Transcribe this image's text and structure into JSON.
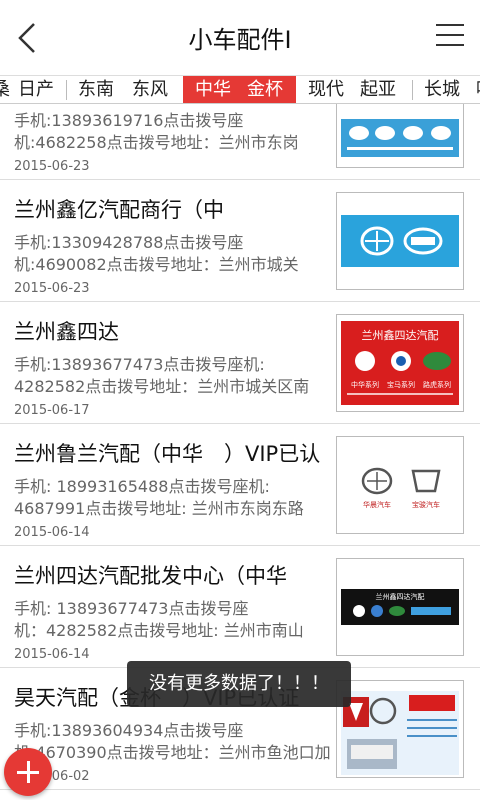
{
  "header": {
    "title": "小车配件Ⅰ"
  },
  "tabs": [
    {
      "label": "桑"
    },
    {
      "label": "日产"
    },
    {
      "label": "东南"
    },
    {
      "label": "东风"
    },
    {
      "label": "中华"
    },
    {
      "label": "金杯"
    },
    {
      "label": "现代"
    },
    {
      "label": "起亚"
    },
    {
      "label": "长城"
    },
    {
      "label": "哈"
    }
  ],
  "items": [
    {
      "name": "",
      "info1": "手机:13893619716点击拨号座",
      "info2": "机:4682258点击拨号地址：兰州市东岗",
      "date": "2015-06-23"
    },
    {
      "name": "兰州鑫亿汽配商行（中",
      "info1": "手机:13309428788点击拨号座",
      "info2": "机:4690082点击拨号地址：兰州市城关",
      "date": "2015-06-23"
    },
    {
      "name": "兰州鑫四达",
      "info1": "手机:13893677473点击拨号座机:",
      "info2": "4282582点击拨号地址：兰州市城关区南",
      "date": "2015-06-17"
    },
    {
      "name": "兰州鲁兰汽配（中华　）VIP已认",
      "info1": "手机: 18993165488点击拨号座机:",
      "info2": "4687991点击拨号地址: 兰州市东岗东路",
      "date": "2015-06-14"
    },
    {
      "name": "兰州四达汽配批发中心（中华",
      "info1": "手机: 13893677473点击拨号座",
      "info2": "机：4282582点击拨号地址: 兰州市南山",
      "date": "2015-06-14"
    },
    {
      "name": "昊天汽配（金杯　）VIP已认证",
      "info1": "手机:13893604934点击拨号座",
      "info2": "机:4670390点击拨号地址：兰州市鱼池口加",
      "date": "2015-06-02"
    }
  ],
  "thumbs": {
    "t3": {
      "title": "兰州鑫四达汽配",
      "l1": "中华系列",
      "l2": "宝马系列",
      "l3": "路虎系列"
    },
    "t4": {
      "l1": "华晨汽车",
      "l2": "宝骏汽车"
    },
    "t5": {
      "title": "兰州鑫四达汽配"
    }
  },
  "toast": "没有更多数据了！！！",
  "colors": {
    "accent": "#e53935"
  }
}
